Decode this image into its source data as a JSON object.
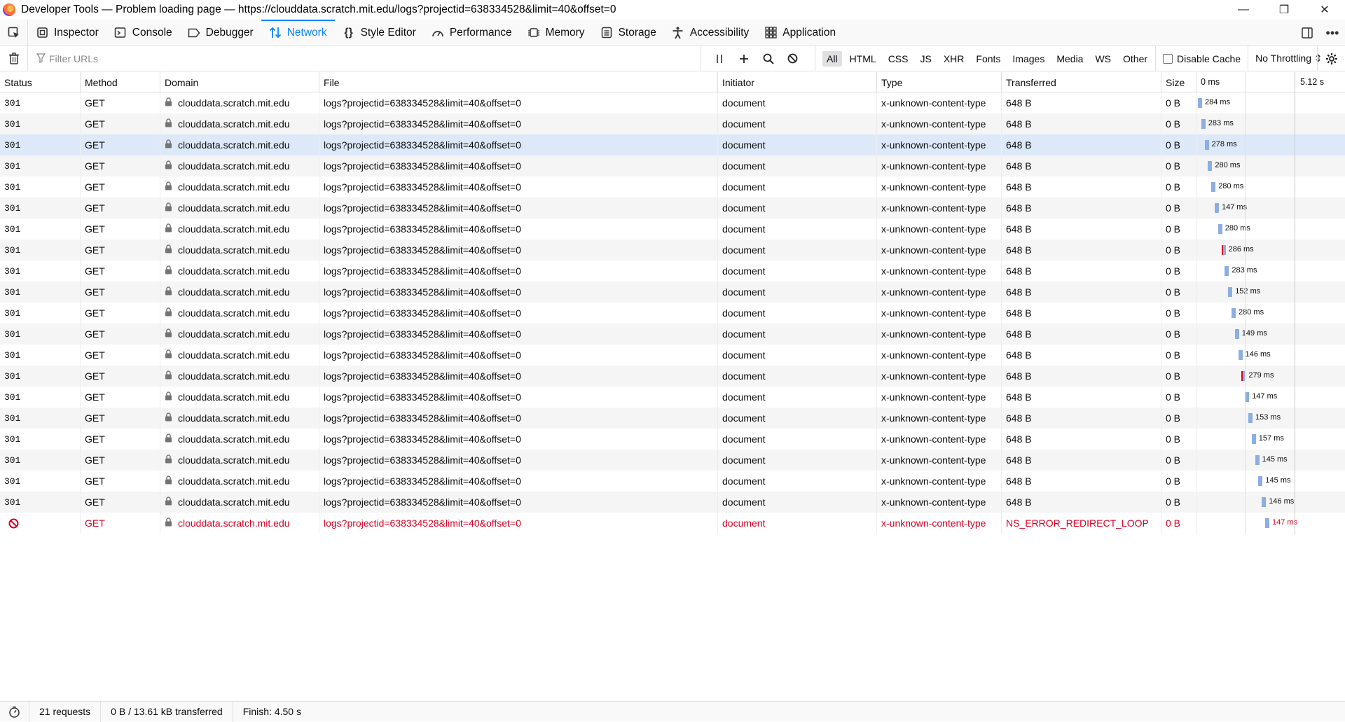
{
  "window": {
    "title": "Developer Tools — Problem loading page — https://clouddata.scratch.mit.edu/logs?projectid=638334528&limit=40&offset=0"
  },
  "toolbar": {
    "tabs": [
      {
        "label": "Inspector",
        "icon": "inspector-icon"
      },
      {
        "label": "Console",
        "icon": "console-icon"
      },
      {
        "label": "Debugger",
        "icon": "debugger-icon"
      },
      {
        "label": "Network",
        "icon": "network-icon",
        "active": true
      },
      {
        "label": "Style Editor",
        "icon": "style-editor-icon"
      },
      {
        "label": "Performance",
        "icon": "performance-icon"
      },
      {
        "label": "Memory",
        "icon": "memory-icon"
      },
      {
        "label": "Storage",
        "icon": "storage-icon"
      },
      {
        "label": "Accessibility",
        "icon": "accessibility-icon"
      },
      {
        "label": "Application",
        "icon": "application-icon"
      }
    ]
  },
  "filter": {
    "placeholder": "Filter URLs",
    "types": [
      "All",
      "HTML",
      "CSS",
      "JS",
      "XHR",
      "Fonts",
      "Images",
      "Media",
      "WS",
      "Other"
    ],
    "selected_type": "All",
    "disable_cache_label": "Disable Cache",
    "throttling": "No Throttling ⇕"
  },
  "table": {
    "columns": [
      "Status",
      "Method",
      "Domain",
      "File",
      "Initiator",
      "Type",
      "Transferred",
      "Size"
    ],
    "waterfall_ticks": [
      "0 ms",
      "5.12 s"
    ],
    "rows": [
      {
        "status": "301",
        "method": "GET",
        "domain": "clouddata.scratch.mit.edu",
        "file": "logs?projectid=638334528&limit=40&offset=0",
        "initiator": "document",
        "type": "x-unknown-content-type",
        "transferred": "648 B",
        "size": "0 B",
        "time": "284 ms"
      },
      {
        "status": "301",
        "method": "GET",
        "domain": "clouddata.scratch.mit.edu",
        "file": "logs?projectid=638334528&limit=40&offset=0",
        "initiator": "document",
        "type": "x-unknown-content-type",
        "transferred": "648 B",
        "size": "0 B",
        "time": "283 ms"
      },
      {
        "status": "301",
        "method": "GET",
        "domain": "clouddata.scratch.mit.edu",
        "file": "logs?projectid=638334528&limit=40&offset=0",
        "initiator": "document",
        "type": "x-unknown-content-type",
        "transferred": "648 B",
        "size": "0 B",
        "time": "278 ms",
        "selected": true
      },
      {
        "status": "301",
        "method": "GET",
        "domain": "clouddata.scratch.mit.edu",
        "file": "logs?projectid=638334528&limit=40&offset=0",
        "initiator": "document",
        "type": "x-unknown-content-type",
        "transferred": "648 B",
        "size": "0 B",
        "time": "280 ms"
      },
      {
        "status": "301",
        "method": "GET",
        "domain": "clouddata.scratch.mit.edu",
        "file": "logs?projectid=638334528&limit=40&offset=0",
        "initiator": "document",
        "type": "x-unknown-content-type",
        "transferred": "648 B",
        "size": "0 B",
        "time": "280 ms"
      },
      {
        "status": "301",
        "method": "GET",
        "domain": "clouddata.scratch.mit.edu",
        "file": "logs?projectid=638334528&limit=40&offset=0",
        "initiator": "document",
        "type": "x-unknown-content-type",
        "transferred": "648 B",
        "size": "0 B",
        "time": "147 ms"
      },
      {
        "status": "301",
        "method": "GET",
        "domain": "clouddata.scratch.mit.edu",
        "file": "logs?projectid=638334528&limit=40&offset=0",
        "initiator": "document",
        "type": "x-unknown-content-type",
        "transferred": "648 B",
        "size": "0 B",
        "time": "280 ms"
      },
      {
        "status": "301",
        "method": "GET",
        "domain": "clouddata.scratch.mit.edu",
        "file": "logs?projectid=638334528&limit=40&offset=0",
        "initiator": "document",
        "type": "x-unknown-content-type",
        "transferred": "648 B",
        "size": "0 B",
        "time": "286 ms",
        "bar_error": true
      },
      {
        "status": "301",
        "method": "GET",
        "domain": "clouddata.scratch.mit.edu",
        "file": "logs?projectid=638334528&limit=40&offset=0",
        "initiator": "document",
        "type": "x-unknown-content-type",
        "transferred": "648 B",
        "size": "0 B",
        "time": "283 ms"
      },
      {
        "status": "301",
        "method": "GET",
        "domain": "clouddata.scratch.mit.edu",
        "file": "logs?projectid=638334528&limit=40&offset=0",
        "initiator": "document",
        "type": "x-unknown-content-type",
        "transferred": "648 B",
        "size": "0 B",
        "time": "152 ms"
      },
      {
        "status": "301",
        "method": "GET",
        "domain": "clouddata.scratch.mit.edu",
        "file": "logs?projectid=638334528&limit=40&offset=0",
        "initiator": "document",
        "type": "x-unknown-content-type",
        "transferred": "648 B",
        "size": "0 B",
        "time": "280 ms"
      },
      {
        "status": "301",
        "method": "GET",
        "domain": "clouddata.scratch.mit.edu",
        "file": "logs?projectid=638334528&limit=40&offset=0",
        "initiator": "document",
        "type": "x-unknown-content-type",
        "transferred": "648 B",
        "size": "0 B",
        "time": "149 ms"
      },
      {
        "status": "301",
        "method": "GET",
        "domain": "clouddata.scratch.mit.edu",
        "file": "logs?projectid=638334528&limit=40&offset=0",
        "initiator": "document",
        "type": "x-unknown-content-type",
        "transferred": "648 B",
        "size": "0 B",
        "time": "146 ms"
      },
      {
        "status": "301",
        "method": "GET",
        "domain": "clouddata.scratch.mit.edu",
        "file": "logs?projectid=638334528&limit=40&offset=0",
        "initiator": "document",
        "type": "x-unknown-content-type",
        "transferred": "648 B",
        "size": "0 B",
        "time": "279 ms",
        "bar_error": true
      },
      {
        "status": "301",
        "method": "GET",
        "domain": "clouddata.scratch.mit.edu",
        "file": "logs?projectid=638334528&limit=40&offset=0",
        "initiator": "document",
        "type": "x-unknown-content-type",
        "transferred": "648 B",
        "size": "0 B",
        "time": "147 ms"
      },
      {
        "status": "301",
        "method": "GET",
        "domain": "clouddata.scratch.mit.edu",
        "file": "logs?projectid=638334528&limit=40&offset=0",
        "initiator": "document",
        "type": "x-unknown-content-type",
        "transferred": "648 B",
        "size": "0 B",
        "time": "153 ms"
      },
      {
        "status": "301",
        "method": "GET",
        "domain": "clouddata.scratch.mit.edu",
        "file": "logs?projectid=638334528&limit=40&offset=0",
        "initiator": "document",
        "type": "x-unknown-content-type",
        "transferred": "648 B",
        "size": "0 B",
        "time": "157 ms"
      },
      {
        "status": "301",
        "method": "GET",
        "domain": "clouddata.scratch.mit.edu",
        "file": "logs?projectid=638334528&limit=40&offset=0",
        "initiator": "document",
        "type": "x-unknown-content-type",
        "transferred": "648 B",
        "size": "0 B",
        "time": "145 ms"
      },
      {
        "status": "301",
        "method": "GET",
        "domain": "clouddata.scratch.mit.edu",
        "file": "logs?projectid=638334528&limit=40&offset=0",
        "initiator": "document",
        "type": "x-unknown-content-type",
        "transferred": "648 B",
        "size": "0 B",
        "time": "145 ms"
      },
      {
        "status": "301",
        "method": "GET",
        "domain": "clouddata.scratch.mit.edu",
        "file": "logs?projectid=638334528&limit=40&offset=0",
        "initiator": "document",
        "type": "x-unknown-content-type",
        "transferred": "648 B",
        "size": "0 B",
        "time": "146 ms"
      },
      {
        "status": "",
        "status_icon": "blocked-icon",
        "error": true,
        "method": "GET",
        "domain": "clouddata.scratch.mit.edu",
        "file": "logs?projectid=638334528&limit=40&offset=0",
        "initiator": "document",
        "type": "x-unknown-content-type",
        "transferred": "NS_ERROR_REDIRECT_LOOP",
        "size": "0 B",
        "time": "147 ms"
      }
    ]
  },
  "statusbar": {
    "requests": "21 requests",
    "transferred": "0 B / 13.61 kB transferred",
    "finish": "Finish: 4.50 s"
  },
  "colors": {
    "accent": "#0a84ff",
    "error": "#d70022",
    "selected_row": "#dde9f8",
    "waterfall_bar": "#8caee3"
  }
}
